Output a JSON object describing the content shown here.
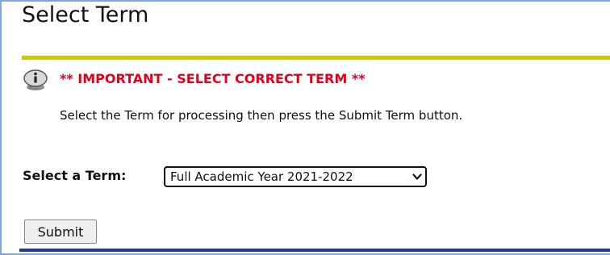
{
  "page": {
    "title": "Select Term"
  },
  "notice": {
    "icon": "info-icon",
    "important_text": "** IMPORTANT - SELECT CORRECT TERM **",
    "instructions": "Select the Term for processing then press the Submit Term button."
  },
  "term_form": {
    "label": "Select a Term:",
    "selected_term": "Full Academic Year 2021-2022",
    "submit_label": "Submit"
  },
  "colors": {
    "divider": "#c9c900",
    "important_text": "#e3001b",
    "bottom_bar": "#1f3f7a",
    "frame_border": "#7fa6d6"
  }
}
